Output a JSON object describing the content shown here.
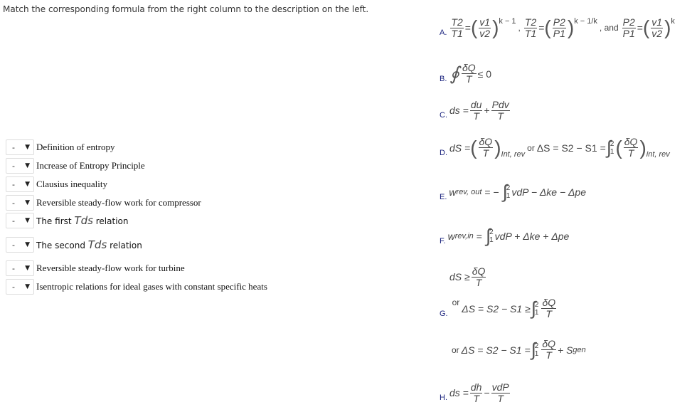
{
  "instruction": "Match the corresponding formula from the right column to the description on the left.",
  "select_value": "-",
  "descriptions": [
    "Definition of entropy",
    "Increase of Entropy Principle",
    "Clausius inequality",
    "Reversible steady-flow work for compressor",
    "The first",
    "The second",
    "Reversible steady-flow work for turbine",
    "Isentropic relations for ideal gases with constant specific heats"
  ],
  "tds": "Tds",
  "relation": "relation",
  "options": {
    "A": {
      "label": "A.",
      "t2": "T2",
      "t1": "T1",
      "v1": "v1",
      "v2": "v2",
      "exp1": "k − 1",
      "p2": "P2",
      "p1": "P1",
      "exp2": "k − 1/k",
      "and": ", and",
      "exp3": "k"
    },
    "B": {
      "label": "B.",
      "oint": "∮",
      "num": "δQ",
      "den": "T",
      "rest": "≤ 0"
    },
    "C": {
      "label": "C.",
      "lhs": "ds =",
      "n1": "du",
      "d1": "T",
      "plus": "+",
      "n2": "Pdv",
      "d2": "T"
    },
    "D": {
      "label": "D.",
      "lhs": "dS =",
      "num": "δQ",
      "den": "T",
      "sub": "Int, rev",
      "or": "or",
      "mid": "ΔS = S2 − S1 =",
      "sub2": "int, rev"
    },
    "E": {
      "label": "E.",
      "lhs": "w",
      "sub": "rev, out",
      "eq": "= −",
      "rest": "vdP − Δke − Δpe"
    },
    "F": {
      "label": "F.",
      "lhs": "w",
      "sub": "rev,in",
      "eq": "=",
      "rest": "vdP + Δke + Δpe"
    },
    "G": {
      "label": "G.",
      "l1": "dS ≥",
      "num": "δQ",
      "den": "T",
      "or": "or",
      "l2": "ΔS = S2 − S1 ≥",
      "l3": "ΔS = S2 − S1 =",
      "plus": "+ S",
      "gen": "gen"
    },
    "H": {
      "label": "H.",
      "lhs": "ds =",
      "n1": "dh",
      "d1": "T",
      "minus": "−",
      "n2": "vdP",
      "d2": "T"
    },
    "int_upper": "2",
    "int_lower": "1"
  }
}
